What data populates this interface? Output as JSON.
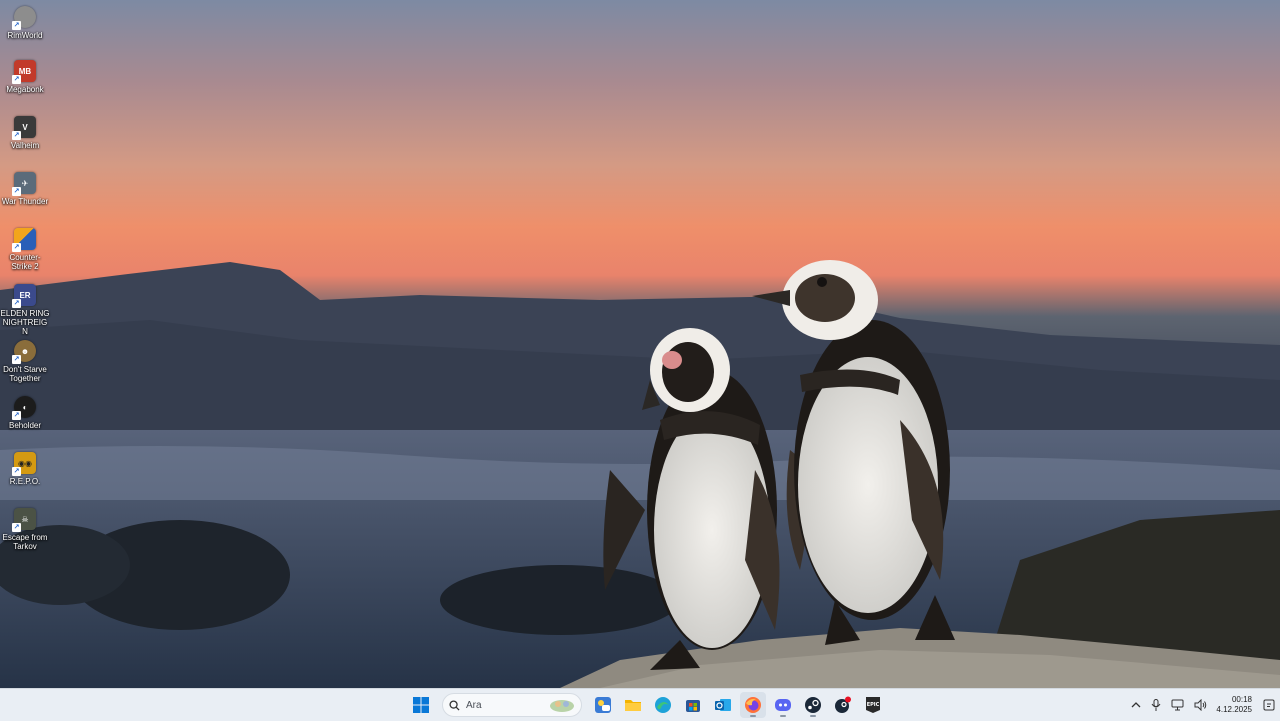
{
  "desktop": {
    "icons": [
      {
        "label": "RimWorld",
        "icon": "rimworld-icon",
        "color": "#8d8d8d"
      },
      {
        "label": "Megabonk",
        "icon": "megabonk-icon",
        "color": "#c23a2a"
      },
      {
        "label": "Valheim",
        "icon": "valheim-icon",
        "color": "#3a3a3a"
      },
      {
        "label": "War Thunder",
        "icon": "war-thunder-icon",
        "color": "#5b6b7a"
      },
      {
        "label": "Counter-Strike 2",
        "icon": "counter-strike-icon",
        "color": "#2a5fb8"
      },
      {
        "label": "ELDEN RING NIGHTREIGN",
        "icon": "elden-ring-icon",
        "color": "#3b4a8c"
      },
      {
        "label": "Don't Starve Together",
        "icon": "dont-starve-icon",
        "color": "#8a6d3b"
      },
      {
        "label": "Beholder",
        "icon": "beholder-icon",
        "color": "#1c1c1c"
      },
      {
        "label": "R.E.P.O.",
        "icon": "repo-icon",
        "color": "#d49a12"
      },
      {
        "label": "Escape from Tarkov",
        "icon": "tarkov-icon",
        "color": "#4b5245"
      }
    ]
  },
  "taskbar": {
    "search_placeholder": "Ara",
    "apps": [
      {
        "icon": "windows-start-icon"
      },
      {
        "icon": "msn-weather-icon"
      },
      {
        "icon": "file-explorer-icon"
      },
      {
        "icon": "edge-icon"
      },
      {
        "icon": "microsoft-store-icon"
      },
      {
        "icon": "outlook-icon"
      },
      {
        "icon": "firefox-icon"
      },
      {
        "icon": "discord-icon"
      },
      {
        "icon": "steam-icon"
      },
      {
        "icon": "steam-notification-icon"
      },
      {
        "icon": "epic-games-icon"
      }
    ],
    "tray": {
      "time": "00:18",
      "date": "4.12.2025"
    }
  }
}
